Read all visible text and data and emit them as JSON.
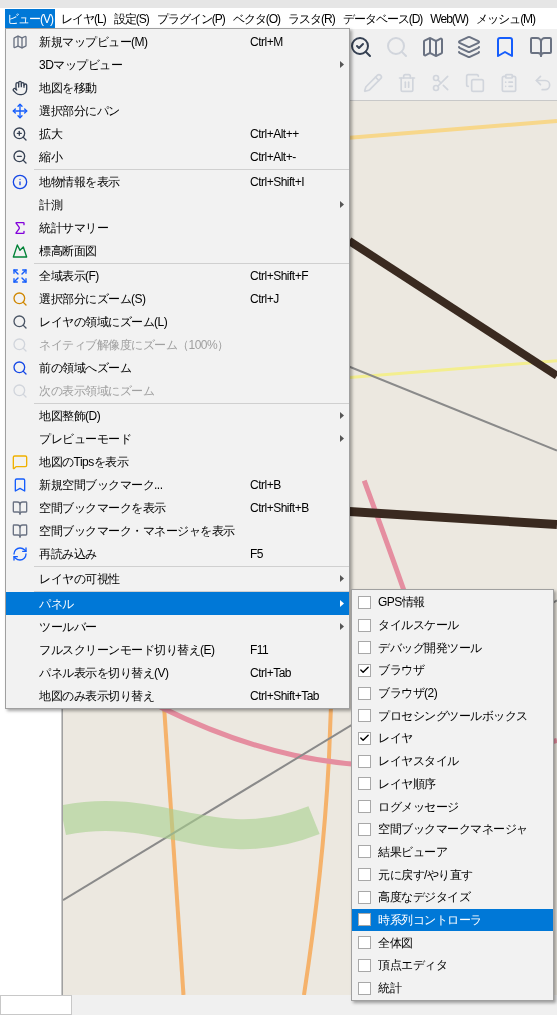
{
  "menubar": [
    {
      "label": "ビュー(V)",
      "selected": true
    },
    {
      "label": "レイヤ(L)",
      "selected": false
    },
    {
      "label": "設定(S)",
      "selected": false
    },
    {
      "label": "プラグイン(P)",
      "selected": false
    },
    {
      "label": "ベクタ(O)",
      "selected": false
    },
    {
      "label": "ラスタ(R)",
      "selected": false
    },
    {
      "label": "データベース(D)",
      "selected": false
    },
    {
      "label": "Web(W)",
      "selected": false
    },
    {
      "label": "メッシュ(M)",
      "selected": false
    }
  ],
  "view_menu": {
    "items": [
      {
        "kind": "item",
        "label": "新規マップビュー(M)",
        "shortcut": "Ctrl+M",
        "submenu": false,
        "disabled": false,
        "selected": false
      },
      {
        "kind": "item",
        "label": "3Dマップビュー",
        "submenu": true,
        "disabled": false,
        "selected": false
      },
      {
        "kind": "item",
        "label": "地図を移動",
        "submenu": false,
        "disabled": false,
        "selected": false
      },
      {
        "kind": "item",
        "label": "選択部分にパン",
        "submenu": false,
        "disabled": false,
        "selected": false
      },
      {
        "kind": "item",
        "label": "拡大",
        "shortcut": "Ctrl+Alt++",
        "submenu": false,
        "disabled": false,
        "selected": false
      },
      {
        "kind": "item",
        "label": "縮小",
        "shortcut": "Ctrl+Alt+-",
        "submenu": false,
        "disabled": false,
        "selected": false
      },
      {
        "kind": "separator"
      },
      {
        "kind": "item",
        "label": "地物情報を表示",
        "shortcut": "Ctrl+Shift+I",
        "submenu": false,
        "disabled": false,
        "selected": false
      },
      {
        "kind": "item",
        "label": "計測",
        "submenu": true,
        "disabled": false,
        "selected": false
      },
      {
        "kind": "item",
        "label": "統計サマリー",
        "submenu": false,
        "disabled": false,
        "selected": false
      },
      {
        "kind": "item",
        "label": "標高断面図",
        "submenu": false,
        "disabled": false,
        "selected": false
      },
      {
        "kind": "separator"
      },
      {
        "kind": "item",
        "label": "全域表示(F)",
        "shortcut": "Ctrl+Shift+F",
        "submenu": false,
        "disabled": false,
        "selected": false
      },
      {
        "kind": "item",
        "label": "選択部分にズーム(S)",
        "shortcut": "Ctrl+J",
        "submenu": false,
        "disabled": false,
        "selected": false
      },
      {
        "kind": "item",
        "label": "レイヤの領域にズーム(L)",
        "submenu": false,
        "disabled": false,
        "selected": false
      },
      {
        "kind": "item",
        "label": "ネイティブ解像度にズーム（100%）",
        "submenu": false,
        "disabled": true,
        "selected": false
      },
      {
        "kind": "item",
        "label": "前の領域へズーム",
        "submenu": false,
        "disabled": false,
        "selected": false
      },
      {
        "kind": "item",
        "label": "次の表示領域にズーム",
        "submenu": false,
        "disabled": true,
        "selected": false
      },
      {
        "kind": "separator"
      },
      {
        "kind": "item",
        "label": "地図整飾(D)",
        "submenu": true,
        "disabled": false,
        "selected": false
      },
      {
        "kind": "item",
        "label": "プレビューモード",
        "submenu": true,
        "disabled": false,
        "selected": false
      },
      {
        "kind": "item",
        "label": "地図のTipsを表示",
        "submenu": false,
        "disabled": false,
        "selected": false
      },
      {
        "kind": "item",
        "label": "新規空間ブックマーク...",
        "shortcut": "Ctrl+B",
        "submenu": false,
        "disabled": false,
        "selected": false
      },
      {
        "kind": "item",
        "label": "空間ブックマークを表示",
        "shortcut": "Ctrl+Shift+B",
        "submenu": false,
        "disabled": false,
        "selected": false
      },
      {
        "kind": "item",
        "label": "空間ブックマーク・マネージャを表示",
        "submenu": false,
        "disabled": false,
        "selected": false
      },
      {
        "kind": "item",
        "label": "再読み込み",
        "shortcut": "F5",
        "submenu": false,
        "disabled": false,
        "selected": false
      },
      {
        "kind": "separator"
      },
      {
        "kind": "item",
        "label": "レイヤの可視性",
        "submenu": true,
        "disabled": false,
        "selected": false
      },
      {
        "kind": "separator"
      },
      {
        "kind": "item",
        "label": "パネル",
        "submenu": true,
        "disabled": false,
        "selected": true
      },
      {
        "kind": "item",
        "label": "ツールバー",
        "submenu": true,
        "disabled": false,
        "selected": false
      },
      {
        "kind": "item",
        "label": "フルスクリーンモード切り替え(E)",
        "shortcut": "F11",
        "submenu": false,
        "disabled": false,
        "selected": false
      },
      {
        "kind": "item",
        "label": "パネル表示を切り替え(V)",
        "shortcut": "Ctrl+Tab",
        "submenu": false,
        "disabled": false,
        "selected": false
      },
      {
        "kind": "item",
        "label": "地図のみ表示切り替え",
        "shortcut": "Ctrl+Shift+Tab",
        "submenu": false,
        "disabled": false,
        "selected": false
      }
    ]
  },
  "panel_menu": {
    "items": [
      {
        "label": "GPS情報",
        "checked": false,
        "selected": false
      },
      {
        "label": "タイルスケール",
        "checked": false,
        "selected": false
      },
      {
        "label": "デバッグ開発ツール",
        "checked": false,
        "selected": false
      },
      {
        "label": "ブラウザ",
        "checked": true,
        "selected": false
      },
      {
        "label": "ブラウザ(2)",
        "checked": false,
        "selected": false
      },
      {
        "label": "プロセシングツールボックス",
        "checked": false,
        "selected": false
      },
      {
        "label": "レイヤ",
        "checked": true,
        "selected": false
      },
      {
        "label": "レイヤスタイル",
        "checked": false,
        "selected": false
      },
      {
        "label": "レイヤ順序",
        "checked": false,
        "selected": false
      },
      {
        "label": "ログメッセージ",
        "checked": false,
        "selected": false
      },
      {
        "label": "空間ブックマークマネージャ",
        "checked": false,
        "selected": false
      },
      {
        "label": "結果ビューア",
        "checked": false,
        "selected": false
      },
      {
        "label": "元に戻す/やり直す",
        "checked": false,
        "selected": false
      },
      {
        "label": "高度なデジタイズ",
        "checked": false,
        "selected": false
      },
      {
        "label": "時系列コントローラ",
        "checked": false,
        "selected": true
      },
      {
        "label": "全体図",
        "checked": false,
        "selected": false
      },
      {
        "label": "頂点エディタ",
        "checked": false,
        "selected": false
      },
      {
        "label": "統計",
        "checked": false,
        "selected": false
      }
    ]
  }
}
